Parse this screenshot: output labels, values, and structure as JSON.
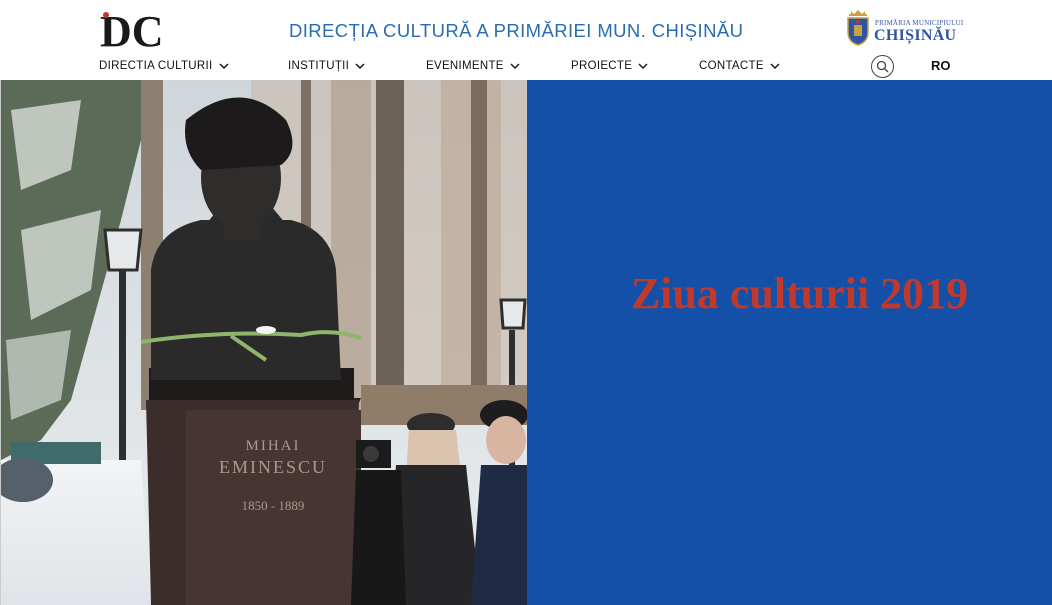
{
  "header": {
    "logo_text": "DC",
    "site_title": "DIRECȚIA CULTURĂ A PRIMĂRIEI MUN. CHIȘINĂU",
    "city_logo_small": "PRIMĂRIA MUNICIPIULUI",
    "city_logo_big": "CHIȘINĂU",
    "language": "RO"
  },
  "nav": {
    "items": [
      {
        "label": "DIRECTIA CULTURII",
        "icon": "chevron-down-icon"
      },
      {
        "label": "INSTITUȚII",
        "icon": "chevron-down-icon"
      },
      {
        "label": "EVENIMENTE",
        "icon": "chevron-down-icon"
      },
      {
        "label": "PROIECTE",
        "icon": "chevron-down-icon"
      },
      {
        "label": "CONTACTE",
        "icon": "chevron-down-icon"
      }
    ],
    "search_icon": "search-icon"
  },
  "hero": {
    "statue_name_line1": "MIHAI",
    "statue_name_line2": "EMINESCU",
    "statue_years": "1850 - 1889",
    "headline": "Ziua culturii 2019",
    "panel_color": "#1450a8",
    "headline_color": "#c0392b"
  }
}
